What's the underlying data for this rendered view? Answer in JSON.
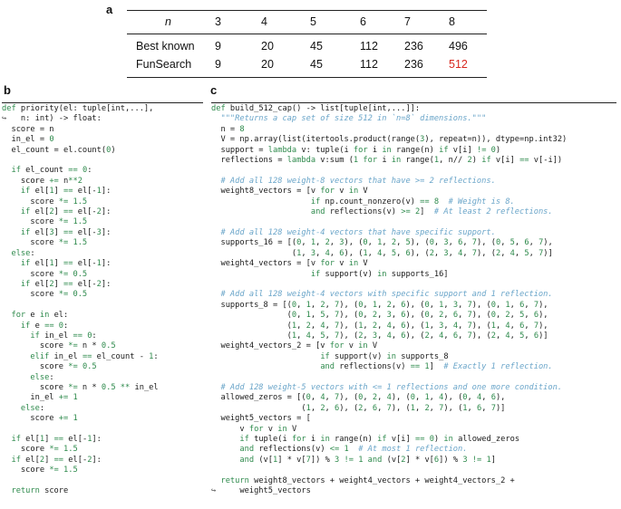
{
  "labels": {
    "a": "a",
    "b": "b",
    "c": "c"
  },
  "table": {
    "header_label": "n",
    "columns": [
      "3",
      "4",
      "5",
      "6",
      "7",
      "8"
    ],
    "rows": [
      {
        "label": "Best known",
        "values": [
          "9",
          "20",
          "45",
          "112",
          "236",
          "496"
        ]
      },
      {
        "label": "FunSearch",
        "values": [
          "9",
          "20",
          "45",
          "112",
          "236",
          "512"
        ]
      }
    ],
    "highlight_color": "#d8281f"
  },
  "code_b": [
    "def priority(el: tuple[int,...],",
    "↪   n: int) -> float:",
    "  score = n",
    "  in_el = 0",
    "  el_count = el.count(0)",
    "",
    "  if el_count == 0:",
    "    score += n**2",
    "    if el[1] == el[-1]:",
    "      score *= 1.5",
    "    if el[2] == el[-2]:",
    "      score *= 1.5",
    "    if el[3] == el[-3]:",
    "      score *= 1.5",
    "  else:",
    "    if el[1] == el[-1]:",
    "      score *= 0.5",
    "    if el[2] == el[-2]:",
    "      score *= 0.5",
    "",
    "  for e in el:",
    "    if e == 0:",
    "      if in_el == 0:",
    "        score *= n * 0.5",
    "      elif in_el == el_count - 1:",
    "        score *= 0.5",
    "      else:",
    "        score *= n * 0.5 ** in_el",
    "      in_el += 1",
    "    else:",
    "      score += 1",
    "",
    "  if el[1] == el[-1]:",
    "    score *= 1.5",
    "  if el[2] == el[-2]:",
    "    score *= 1.5",
    "",
    "  return score"
  ],
  "code_c": [
    "def build_512_cap() -> list[tuple[int,...]]:",
    "  \"\"\"Returns a cap set of size 512 in `n=8` dimensions.\"\"\"",
    "  n = 8",
    "  V = np.array(list(itertools.product(range(3), repeat=n)), dtype=np.int32)",
    "  support = lambda v: tuple(i for i in range(n) if v[i] != 0)",
    "  reflections = lambda v:sum (1 for i in range(1, n// 2) if v[i] == v[-i])",
    "",
    "  # Add all 128 weight-8 vectors that have >= 2 reflections.",
    "  weight8_vectors = [v for v in V",
    "                     if np.count_nonzero(v) == 8  # Weight is 8.",
    "                     and reflections(v) >= 2]  # At least 2 reflections.",
    "",
    "  # Add all 128 weight-4 vectors that have specific support.",
    "  supports_16 = [(0, 1, 2, 3), (0, 1, 2, 5), (0, 3, 6, 7), (0, 5, 6, 7),",
    "                 (1, 3, 4, 6), (1, 4, 5, 6), (2, 3, 4, 7), (2, 4, 5, 7)]",
    "  weight4_vectors = [v for v in V",
    "                     if support(v) in supports_16]",
    "",
    "  # Add all 128 weight-4 vectors with specific support and 1 reflection.",
    "  supports_8 = [(0, 1, 2, 7), (0, 1, 2, 6), (0, 1, 3, 7), (0, 1, 6, 7),",
    "                (0, 1, 5, 7), (0, 2, 3, 6), (0, 2, 6, 7), (0, 2, 5, 6),",
    "                (1, 2, 4, 7), (1, 2, 4, 6), (1, 3, 4, 7), (1, 4, 6, 7),",
    "                (1, 4, 5, 7), (2, 3, 4, 6), (2, 4, 6, 7), (2, 4, 5, 6)]",
    "  weight4_vectors_2 = [v for v in V",
    "                       if support(v) in supports_8",
    "                       and reflections(v) == 1]  # Exactly 1 reflection.",
    "",
    "  # Add 128 weight-5 vectors with <= 1 reflections and one more condition.",
    "  allowed_zeros = [(0, 4, 7), (0, 2, 4), (0, 1, 4), (0, 4, 6),",
    "                   (1, 2, 6), (2, 6, 7), (1, 2, 7), (1, 6, 7)]",
    "  weight5_vectors = [",
    "      v for v in V",
    "      if tuple(i for i in range(n) if v[i] == 0) in allowed_zeros",
    "      and reflections(v) <= 1  # At most 1 reflection.",
    "      and (v[1] * v[7]) % 3 != 1 and (v[2] * v[6]) % 3 != 1]",
    "",
    "  return weight8_vectors + weight4_vectors + weight4_vectors_2 +",
    "↪     weight5_vectors"
  ]
}
